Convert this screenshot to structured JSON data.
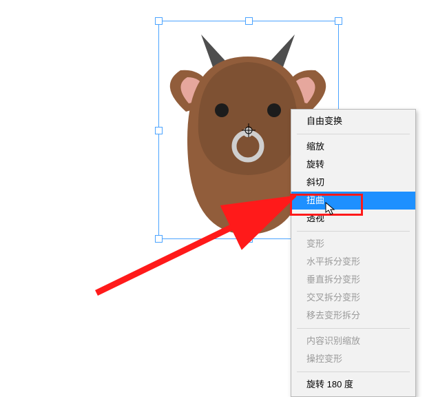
{
  "menu": {
    "free_transform": "自由变换",
    "scale": "缩放",
    "rotate": "旋转",
    "skew": "斜切",
    "distort": "扭曲",
    "perspective": "透视",
    "warp": "变形",
    "split_h": "水平拆分变形",
    "split_v": "垂直拆分变形",
    "split_x": "交叉拆分变形",
    "remove_split": "移去变形拆分",
    "content_aware": "内容识别缩放",
    "puppet": "操控变形",
    "rotate_180": "旋转 180 度"
  },
  "artwork": {
    "subject": "cartoon-cow-head"
  }
}
